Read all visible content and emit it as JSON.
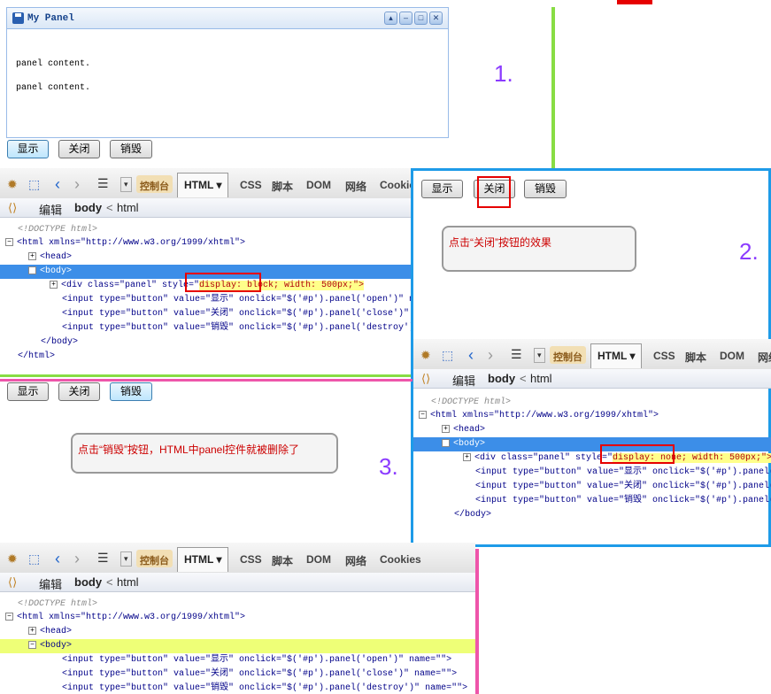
{
  "panel": {
    "title": "My Panel",
    "content_line_1": "panel content.",
    "content_line_2": "panel content.",
    "tool_icons": [
      "collapse-icon",
      "minimize-icon",
      "maximize-icon",
      "close-icon"
    ]
  },
  "buttons": {
    "show": "显示",
    "close": "关闭",
    "destroy": "销毁"
  },
  "firebug": {
    "tabs": [
      "控制台",
      "HTML",
      "CSS",
      "脚本",
      "DOM",
      "网络",
      "Cookies"
    ],
    "html_tab_label": "HTML ▾",
    "crumb_edit": "编辑",
    "crumb_body": "body",
    "crumb_sep": "<",
    "crumb_html": "html"
  },
  "tree": {
    "doctype": "<!DOCTYPE html>",
    "html_open": "<html xmlns=\"http://www.w3.org/1999/xhtml\">",
    "head": "<head>",
    "body_open": "<body>",
    "div_pre": "<div class=\"panel\" style=\"",
    "div_block": "display: block;",
    "div_post": " width: 500px;\">",
    "div_none": "display: none;",
    "input_show": "<input type=\"button\" value=\"显示\" onclick=\"$('#p').panel('open')\" name=\"\">",
    "input_close": "<input type=\"button\" value=\"关闭\" onclick=\"$('#p').panel('close')\" name=\"\">",
    "input_destroy": "<input type=\"button\" value=\"销毁\" onclick=\"$('#p').panel('destroy')\" name=\"\">",
    "body_close": "</body>",
    "html_close": "</html>"
  },
  "callouts": {
    "close_effect": "点击“关闭”按钮的效果",
    "destroy_effect": "点击“销毁”按钮，HTML中panel控件就被删除了"
  },
  "numbers": {
    "one": "1.",
    "two": "2.",
    "three": "3."
  },
  "colors": {
    "green_divider": "#88dd44",
    "blue_frame": "#1e9be8",
    "pink_divider": "#ee55aa",
    "red_box": "#e60000",
    "number_purple": "#8b3bff"
  }
}
